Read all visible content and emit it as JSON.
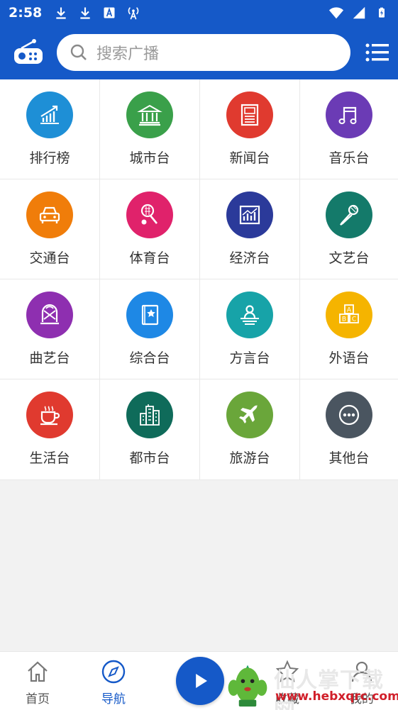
{
  "status_bar": {
    "time": "2:58"
  },
  "search": {
    "placeholder": "搜索广播"
  },
  "categories": [
    {
      "label": "排行榜",
      "icon": "ranking-icon",
      "color": "#1e8fd6"
    },
    {
      "label": "城市台",
      "icon": "city-building-icon",
      "color": "#3aa04a"
    },
    {
      "label": "新闻台",
      "icon": "newspaper-icon",
      "color": "#e03a2f"
    },
    {
      "label": "音乐台",
      "icon": "music-note-icon",
      "color": "#6b3bb5"
    },
    {
      "label": "交通台",
      "icon": "car-icon",
      "color": "#f07d0a"
    },
    {
      "label": "体育台",
      "icon": "racket-ball-icon",
      "color": "#e0226b"
    },
    {
      "label": "经济台",
      "icon": "economy-chart-icon",
      "color": "#2b3a9a"
    },
    {
      "label": "文艺台",
      "icon": "microphone-icon",
      "color": "#147a6a"
    },
    {
      "label": "曲艺台",
      "icon": "opera-mask-icon",
      "color": "#8e2fb0"
    },
    {
      "label": "综合台",
      "icon": "book-star-icon",
      "color": "#1e88e5"
    },
    {
      "label": "方言台",
      "icon": "speaker-podium-icon",
      "color": "#17a3a8"
    },
    {
      "label": "外语台",
      "icon": "abc-blocks-icon",
      "color": "#f5b400"
    },
    {
      "label": "生活台",
      "icon": "coffee-cup-icon",
      "color": "#e03a2f"
    },
    {
      "label": "都市台",
      "icon": "skyscraper-icon",
      "color": "#0f6b5a"
    },
    {
      "label": "旅游台",
      "icon": "airplane-icon",
      "color": "#6aa63a"
    },
    {
      "label": "其他台",
      "icon": "more-dots-icon",
      "color": "#4a5560"
    }
  ],
  "bottom_nav": {
    "home_label": "首页",
    "nav_label": "导航",
    "favorites_label": "收藏",
    "mine_label": "我的"
  },
  "watermark": {
    "text": "仙人掌下载网",
    "url": "www.hebxqrc.com"
  },
  "colors": {
    "primary": "#1559c8",
    "background": "#f2f2f2"
  }
}
